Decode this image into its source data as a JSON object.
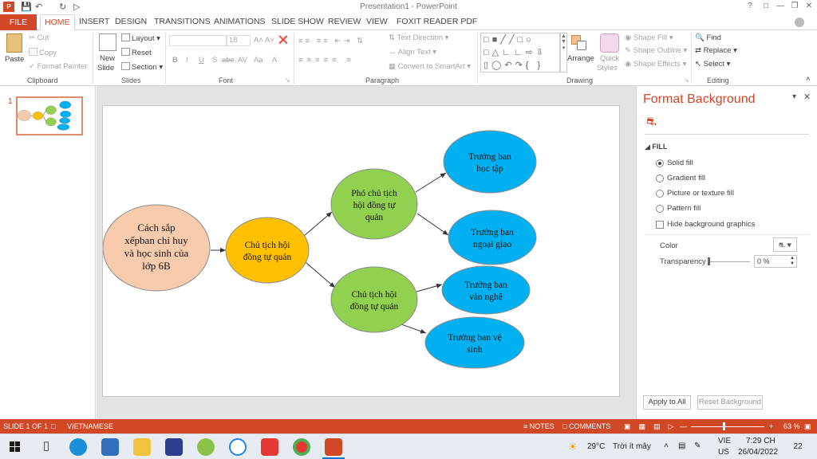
{
  "window": {
    "title": "Presentation1 - PowerPoint"
  },
  "tabs": [
    "FILE",
    "HOME",
    "INSERT",
    "DESIGN",
    "TRANSITIONS",
    "ANIMATIONS",
    "SLIDE SHOW",
    "REVIEW",
    "VIEW",
    "FOXIT READER PDF"
  ],
  "ribbon": {
    "clipboard": {
      "paste": "Paste",
      "cut": "Cut",
      "copy": "Copy",
      "format_painter": "Format Painter",
      "label": "Clipboard"
    },
    "slides": {
      "new_slide_1": "New",
      "new_slide_2": "Slide",
      "layout": "Layout",
      "reset": "Reset",
      "section": "Section",
      "label": "Slides"
    },
    "font": {
      "size": "18",
      "label": "Font",
      "buttons": [
        "B",
        "I",
        "U",
        "S",
        "abc",
        "AV",
        "Aa",
        "A"
      ]
    },
    "paragraph": {
      "text_direction": "Text Direction",
      "align_text": "Align Text",
      "smartart": "Convert to SmartArt",
      "label": "Paragraph"
    },
    "drawing": {
      "arrange": "Arrange",
      "quick_styles_1": "Quick",
      "quick_styles_2": "Styles",
      "shape_fill": "Shape Fill",
      "shape_outline": "Shape Outline",
      "shape_effects": "Shape Effects",
      "label": "Drawing"
    },
    "editing": {
      "find": "Find",
      "replace": "Replace",
      "select": "Select",
      "label": "Editing"
    }
  },
  "thumbnails": {
    "slide_number": "1"
  },
  "slide": {
    "nodes": [
      {
        "lines": [
          "Cách sắp",
          "xếpban chỉ huy",
          "và học sinh của",
          "lớp 6B"
        ],
        "fill": "#f8cbad"
      },
      {
        "lines": [
          "Chủ tịch hội",
          "đồng tự quản"
        ],
        "fill": "#ffc000"
      },
      {
        "lines": [
          "Phó chủ tịch",
          "hội đồng tự",
          "quản"
        ],
        "fill": "#92d050"
      },
      {
        "lines": [
          "Chủ tịch hội",
          "đồng tự quản"
        ],
        "fill": "#92d050"
      },
      {
        "lines": [
          "Trưởng ban",
          "học tập"
        ],
        "fill": "#00b0f0"
      },
      {
        "lines": [
          "Trưởng ban",
          "ngoại giao"
        ],
        "fill": "#00b0f0"
      },
      {
        "lines": [
          "Trưởng ban",
          "văn nghệ"
        ],
        "fill": "#00b0f0"
      },
      {
        "lines": [
          "Trưởng ban vệ",
          "sinh"
        ],
        "fill": "#00b0f0"
      }
    ]
  },
  "format_pane": {
    "title": "Format Background",
    "section": "FILL",
    "options": [
      "Solid fill",
      "Gradient fill",
      "Picture or texture fill",
      "Pattern fill"
    ],
    "selected": "Solid fill",
    "hide_bg": "Hide background graphics",
    "color_label": "Color",
    "transparency_label": "Transparency",
    "transparency_value": "0 %",
    "apply_all": "Apply to All",
    "reset_bg": "Reset Background"
  },
  "status": {
    "slide": "SLIDE 1 OF 1",
    "language": "VIETNAMESE",
    "notes": "NOTES",
    "comments": "COMMENTS",
    "zoom": "63 %"
  },
  "taskbar": {
    "weather_temp": "29°C",
    "weather_text": "Trời ít mây",
    "lang_1": "VIE",
    "lang_2": "US",
    "time": "7:29 CH",
    "date": "26/04/2022",
    "notif": "22"
  },
  "colors": {
    "accent": "#d24726"
  }
}
